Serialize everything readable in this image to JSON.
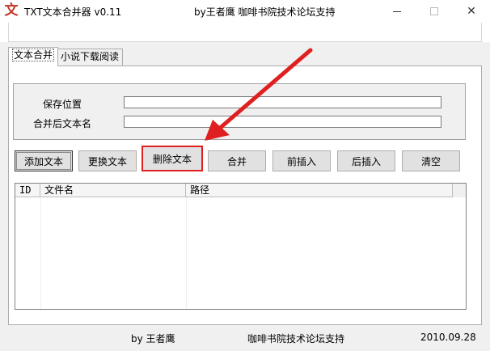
{
  "window": {
    "app_title": "TXT文本合并器 v0.11",
    "center_title": "by王者鹰 咖啡书院技术论坛支持",
    "icon_glyph": "文",
    "minimize_glyph": "",
    "maximize_glyph": "",
    "close_glyph": "✕"
  },
  "tabs": [
    {
      "label": "文本合并",
      "active": true
    },
    {
      "label": "小说下载阅读",
      "active": false
    }
  ],
  "form": {
    "save_location_label": "保存位置",
    "save_location_value": "",
    "merged_name_label": "合并后文本名",
    "merged_name_value": ""
  },
  "buttons": {
    "add": "添加文本",
    "replace": "更换文本",
    "delete": "删除文本",
    "merge": "合并",
    "insert_before": "前插入",
    "insert_after": "后插入",
    "clear": "清空"
  },
  "table": {
    "columns": [
      "ID",
      "文件名",
      "路径"
    ],
    "rows": []
  },
  "status": {
    "author": "by 王者鹰",
    "support": "咖啡书院技术论坛支持",
    "date": "2010.09.28"
  },
  "colors": {
    "annotation_red": "#e02020",
    "icon_red": "#c0392b"
  }
}
